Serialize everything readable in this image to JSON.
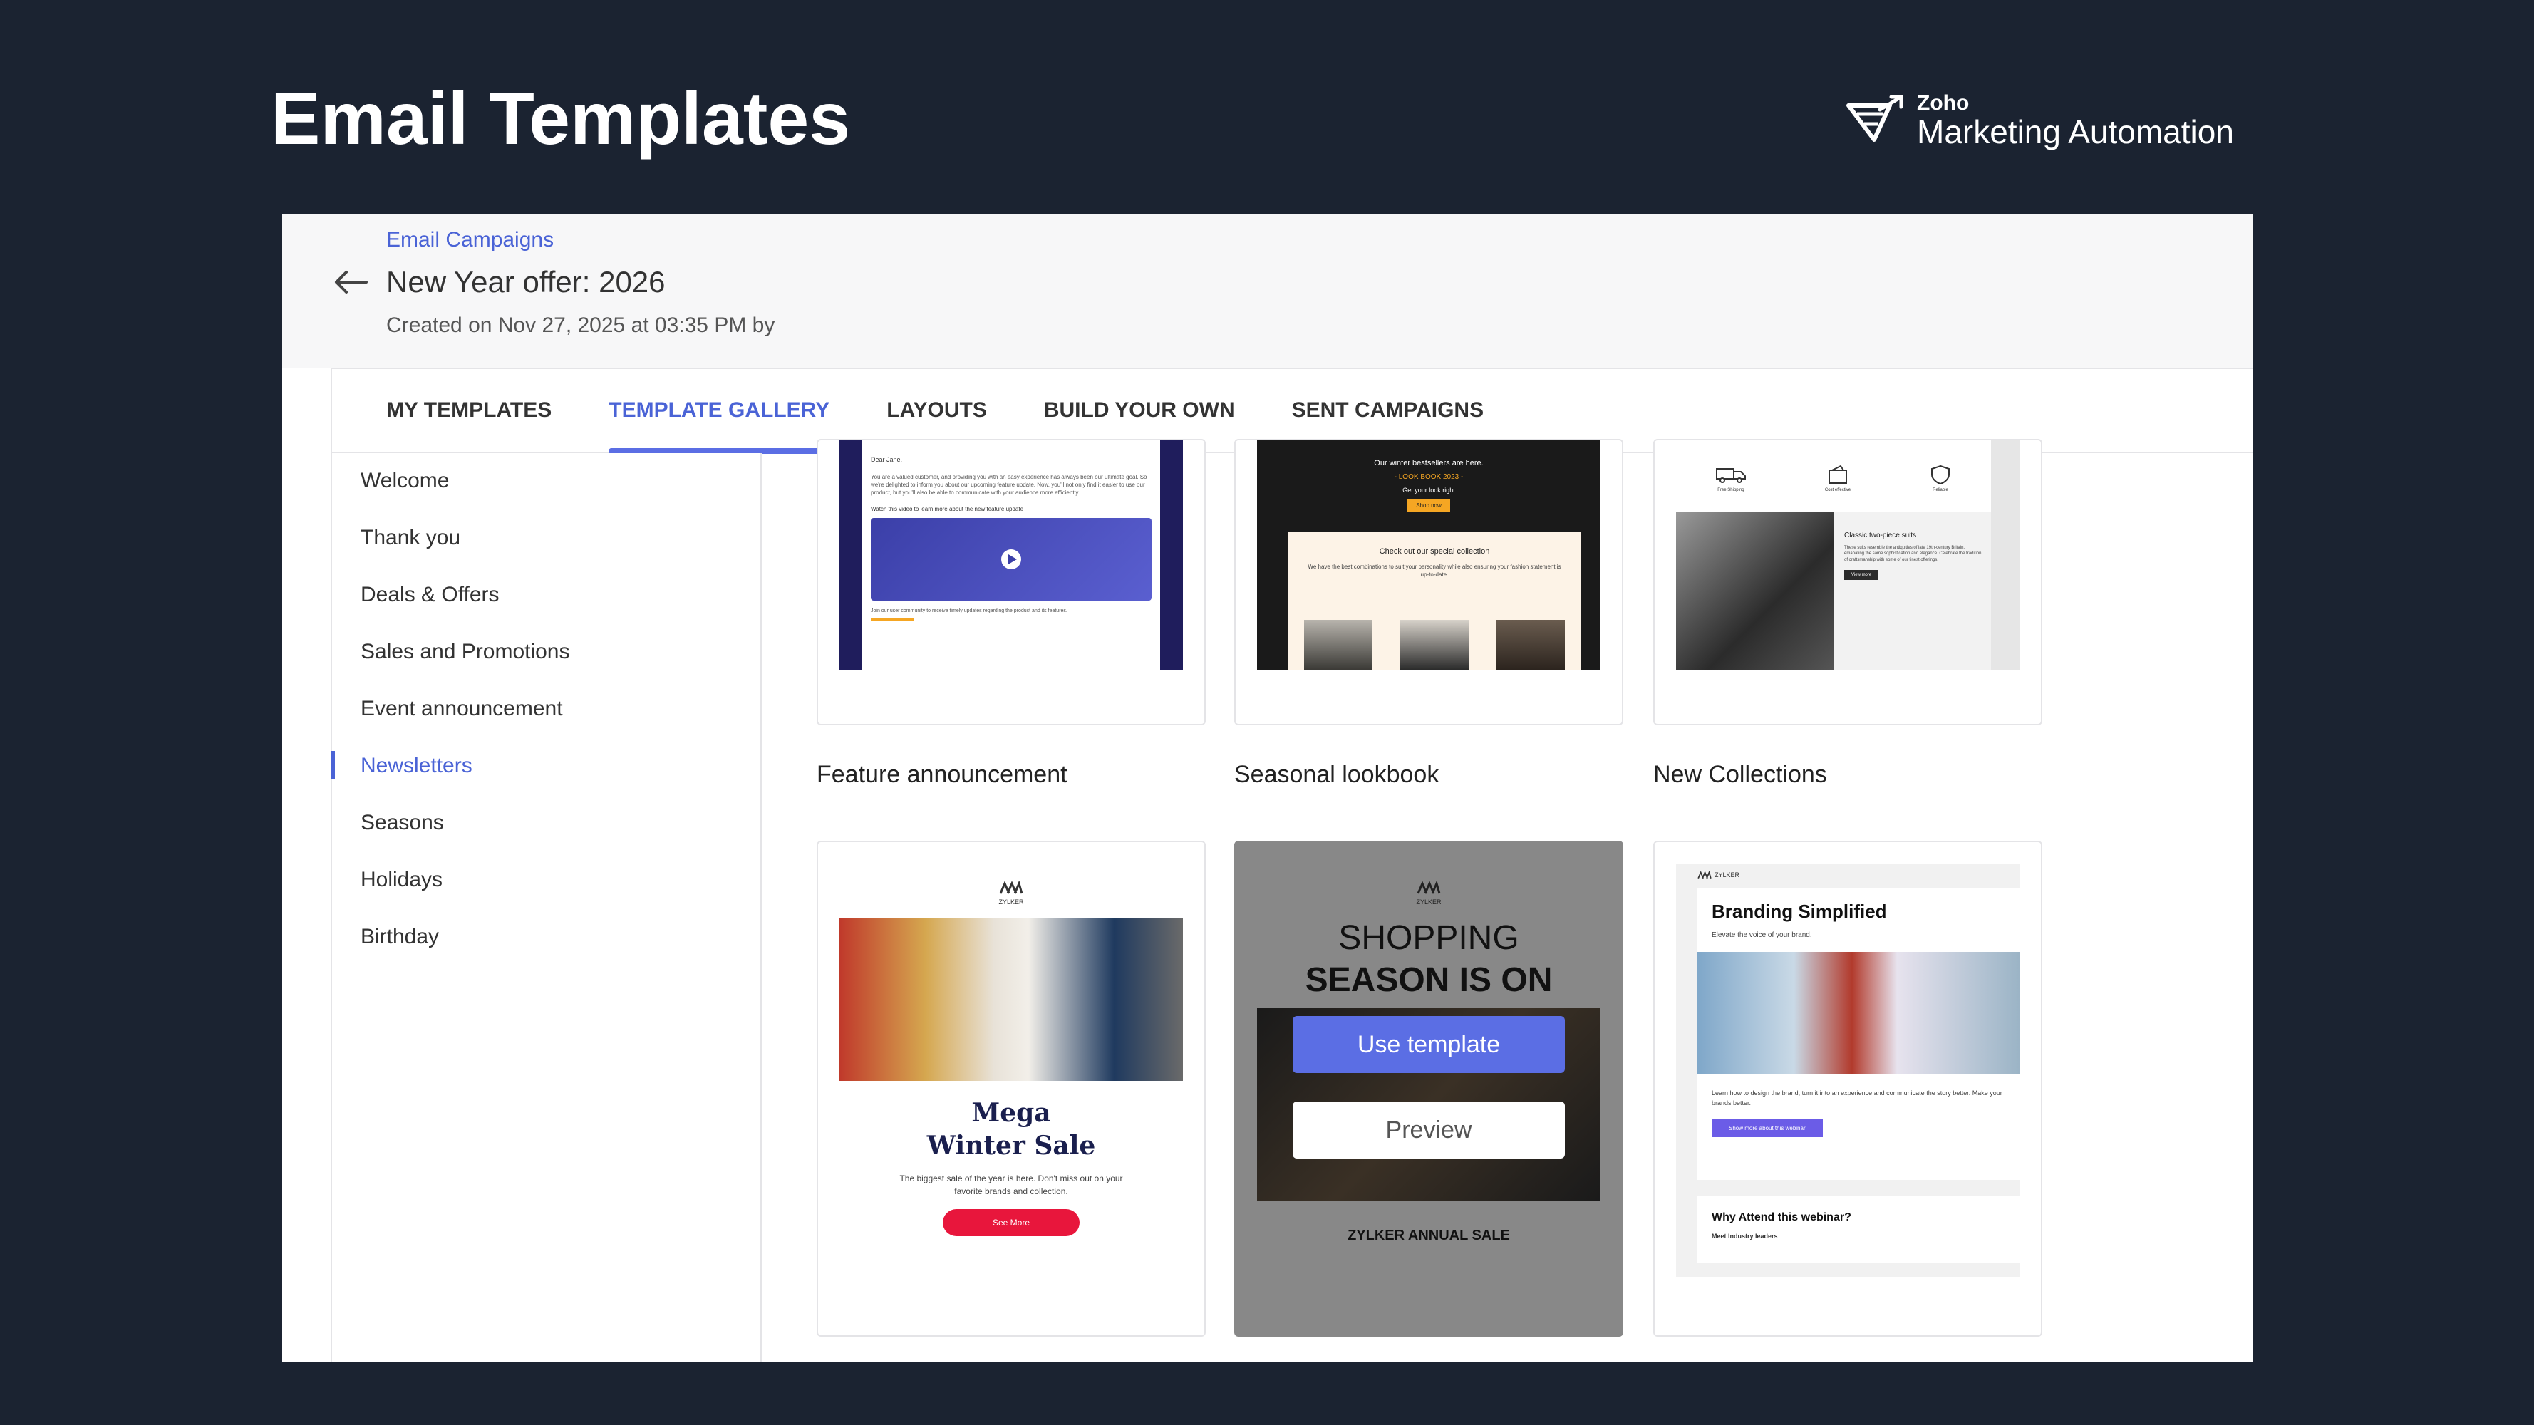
{
  "page_title": "Email Templates",
  "brand": {
    "small": "Zoho",
    "big": "Marketing Automation"
  },
  "header": {
    "breadcrumb": "Email Campaigns",
    "campaign_title": "New Year offer: 2026",
    "created": "Created on Nov 27, 2025 at 03:35 PM by"
  },
  "tabs": [
    {
      "label": "MY TEMPLATES",
      "active": false
    },
    {
      "label": "TEMPLATE GALLERY",
      "active": true
    },
    {
      "label": "LAYOUTS",
      "active": false
    },
    {
      "label": "BUILD YOUR OWN",
      "active": false
    },
    {
      "label": "SENT CAMPAIGNS",
      "active": false
    }
  ],
  "sidebar": {
    "items": [
      "Welcome",
      "Thank you",
      "Deals & Offers",
      "Sales and Promotions",
      "Event announcement",
      "Newsletters",
      "Seasons",
      "Holidays",
      "Birthday"
    ],
    "active": "Newsletters"
  },
  "templates_row1": [
    {
      "label": "Feature announcement",
      "thumb": {
        "greeting": "Dear Jane,",
        "body": "You are a valued customer, and providing you with an easy experience has always been our ultimate goal. So we're delighted to inform you about our upcoming feature update. Now, you'll not only find it easier to use our product, but you'll also be able to communicate with your audience more efficiently.",
        "video_caption": "Watch this video to learn more about the new feature update",
        "footer": "Join our user community to receive timely updates regarding the product and its features."
      }
    },
    {
      "label": "Seasonal lookbook",
      "thumb": {
        "headline": "Our winter bestsellers are here.",
        "subhead": "- LOOK BOOK 2023 -",
        "tagline": "Get your look right",
        "button": "Shop now",
        "section_title": "Check out our special collection",
        "section_body": "We have the best combinations to suit your personality while also ensuring your fashion statement is up-to-date."
      }
    },
    {
      "label": "New Collections",
      "thumb": {
        "icons": [
          "Free Shipping",
          "Cost effective",
          "Reliable"
        ],
        "title": "Classic two-piece suits",
        "body": "These suits resemble the antiquities of late 19th-century Britain, emanating the same sophistication and elegance. Celebrate the tradition of craftsmanship with some of our finest offerings.",
        "button": "View more"
      }
    }
  ],
  "templates_row2": [
    {
      "logo": "ZYLKER",
      "title_line1": "Mega",
      "title_line2": "Winter Sale",
      "body": "The biggest sale of the year is here. Don't miss out on your favorite brands and collection.",
      "button": "See More"
    },
    {
      "logo": "ZYLKER",
      "line1": "SHOPPING",
      "line2": "SEASON IS ON",
      "footer": "ZYLKER ANNUAL SALE",
      "use_template": "Use template",
      "preview": "Preview"
    },
    {
      "logo": "ZYLKER",
      "title": "Branding Simplified",
      "subtitle": "Elevate the voice of your brand.",
      "body": "Learn how to design the brand; turn it into an experience and communicate the story better. Make your brands better.",
      "button": "Show more about this webinar",
      "section_title": "Why Attend this webinar?",
      "section_body": "Meet Industry leaders"
    }
  ],
  "colors": {
    "background": "#1b2331",
    "accent": "#4a63d6",
    "button": "#5b6ee4",
    "sale_red": "#e8163c"
  }
}
